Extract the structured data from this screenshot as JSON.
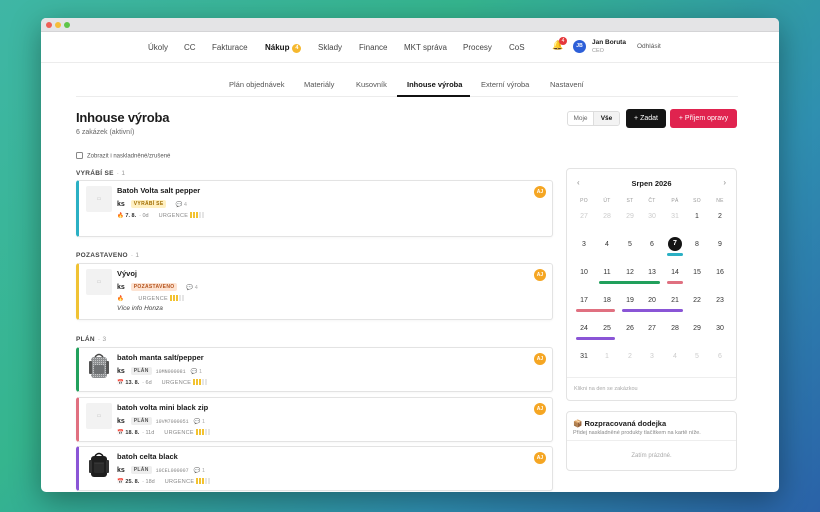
{
  "nav": {
    "items": [
      {
        "label": "Úkoly"
      },
      {
        "label": "CC"
      },
      {
        "label": "Fakturace"
      },
      {
        "label": "Nákup",
        "badge": "4",
        "active": true
      },
      {
        "label": "Sklady"
      },
      {
        "label": "Finance"
      },
      {
        "label": "MKT správa"
      },
      {
        "label": "Procesy"
      },
      {
        "label": "CoS"
      }
    ],
    "bell_badge": "4",
    "user": {
      "initials": "JB",
      "name": "Jan Boruta",
      "role": "CEO"
    },
    "logout": "Odhlásit"
  },
  "subtabs": [
    "Plán objednávek",
    "Materiály",
    "Kusovník",
    "Inhouse výroba",
    "Externí výroba",
    "Nastavení"
  ],
  "page": {
    "title": "Inhouse výroba",
    "subtitle": "6 zakázek (aktivní)",
    "filter_mine": "Moje",
    "filter_all": "Vše",
    "btn_add": "+ Zadat",
    "btn_repair": "+ Příjem opravy",
    "show_stocked": "Zobrazit i naskladněné/zrušené"
  },
  "sections": [
    {
      "title": "VYRÁBÍ SE",
      "count": "· 1"
    },
    {
      "title": "POZASTAVENO",
      "count": "· 1"
    },
    {
      "title": "PLÁN",
      "count": "· 3"
    }
  ],
  "cards": [
    {
      "title": "Batoh Volta salt pepper",
      "unit": "ks",
      "status": "VYRÁBÍ SE",
      "code": "",
      "comments": "💬 4",
      "date_icon": "🔥",
      "date": "7. 8.",
      "ago": "· 0d",
      "urgency": "URGENCE",
      "level": 3,
      "note": "",
      "assignee": "AJ",
      "color": "#2bb0c4",
      "thumb": "placeholder"
    },
    {
      "title": "Vývoj",
      "unit": "ks",
      "status": "POZASTAVENO",
      "code": "",
      "comments": "💬 4",
      "date_icon": "🔥",
      "date": "",
      "ago": "",
      "urgency": "URGENCE",
      "level": 3,
      "note": "Více info Honza",
      "assignee": "AJ",
      "color": "#f0c234",
      "thumb": "placeholder"
    },
    {
      "title": "batoh manta salt/pepper",
      "unit": "ks",
      "status": "PLÁN",
      "code": "10MN000081",
      "comments": "💬 1",
      "date_icon": "📅",
      "date": "13. 8.",
      "ago": "· 6d",
      "urgency": "URGENCE",
      "level": 3,
      "note": "",
      "assignee": "AJ",
      "color": "#21a05c",
      "thumb": "bag-grey"
    },
    {
      "title": "batoh volta mini black zip",
      "unit": "ks",
      "status": "PLÁN",
      "code": "10VM7000051",
      "comments": "💬 1",
      "date_icon": "📅",
      "date": "18. 8.",
      "ago": "· 11d",
      "urgency": "URGENCE",
      "level": 3,
      "note": "",
      "assignee": "AJ",
      "color": "#e07080",
      "thumb": "placeholder"
    },
    {
      "title": "batoh celta black",
      "unit": "ks",
      "status": "PLÁN",
      "code": "10CEL000007",
      "comments": "💬 1",
      "date_icon": "📅",
      "date": "25. 8.",
      "ago": "· 18d",
      "urgency": "URGENCE",
      "level": 3,
      "note": "",
      "assignee": "AJ",
      "color": "#8a55d6",
      "thumb": "bag-black"
    }
  ],
  "calendar": {
    "month": "Srpen 2026",
    "prev": "‹",
    "next": "›",
    "weekdays": [
      "PO",
      "ÚT",
      "ST",
      "ČT",
      "PÁ",
      "SO",
      "NE"
    ],
    "weeks": [
      [
        [
          "27",
          1
        ],
        [
          "28",
          1
        ],
        [
          "29",
          1
        ],
        [
          "30",
          1
        ],
        [
          "31",
          1
        ],
        [
          "1",
          0
        ],
        [
          "2",
          0
        ]
      ],
      [
        [
          "3",
          0
        ],
        [
          "4",
          0
        ],
        [
          "5",
          0
        ],
        [
          "6",
          0
        ],
        [
          "7",
          0
        ],
        [
          "8",
          0
        ],
        [
          "9",
          0
        ]
      ],
      [
        [
          "10",
          0
        ],
        [
          "11",
          0
        ],
        [
          "12",
          0
        ],
        [
          "13",
          0
        ],
        [
          "14",
          0
        ],
        [
          "15",
          0
        ],
        [
          "16",
          0
        ]
      ],
      [
        [
          "17",
          0
        ],
        [
          "18",
          0
        ],
        [
          "19",
          0
        ],
        [
          "20",
          0
        ],
        [
          "21",
          0
        ],
        [
          "22",
          0
        ],
        [
          "23",
          0
        ]
      ],
      [
        [
          "24",
          0
        ],
        [
          "25",
          0
        ],
        [
          "26",
          0
        ],
        [
          "27",
          0
        ],
        [
          "28",
          0
        ],
        [
          "29",
          0
        ],
        [
          "30",
          0
        ]
      ],
      [
        [
          "31",
          0
        ],
        [
          "1",
          1
        ],
        [
          "2",
          1
        ],
        [
          "3",
          1
        ],
        [
          "4",
          1
        ],
        [
          "5",
          1
        ],
        [
          "6",
          1
        ]
      ]
    ],
    "today": "7",
    "events": [
      {
        "row": 1,
        "from": 4,
        "to": 4,
        "color": "#2bb0c4"
      },
      {
        "row": 2,
        "from": 1,
        "to": 3,
        "color": "#21a05c"
      },
      {
        "row": 2,
        "from": 4,
        "to": 4,
        "color": "#e07080"
      },
      {
        "row": 3,
        "from": 0,
        "to": 1,
        "color": "#e07080"
      },
      {
        "row": 3,
        "from": 2,
        "to": 4,
        "color": "#8a55d6"
      },
      {
        "row": 4,
        "from": 0,
        "to": 1,
        "color": "#8a55d6"
      }
    ],
    "hint": "Klikni na den se zakázkou"
  },
  "receipt": {
    "icon": "📦",
    "title": "Rozpracovaná dodejka",
    "subtitle": "Přidej naskladněné produkty tlačítkem na kartě níže.",
    "empty": "Zatím prázdné."
  }
}
